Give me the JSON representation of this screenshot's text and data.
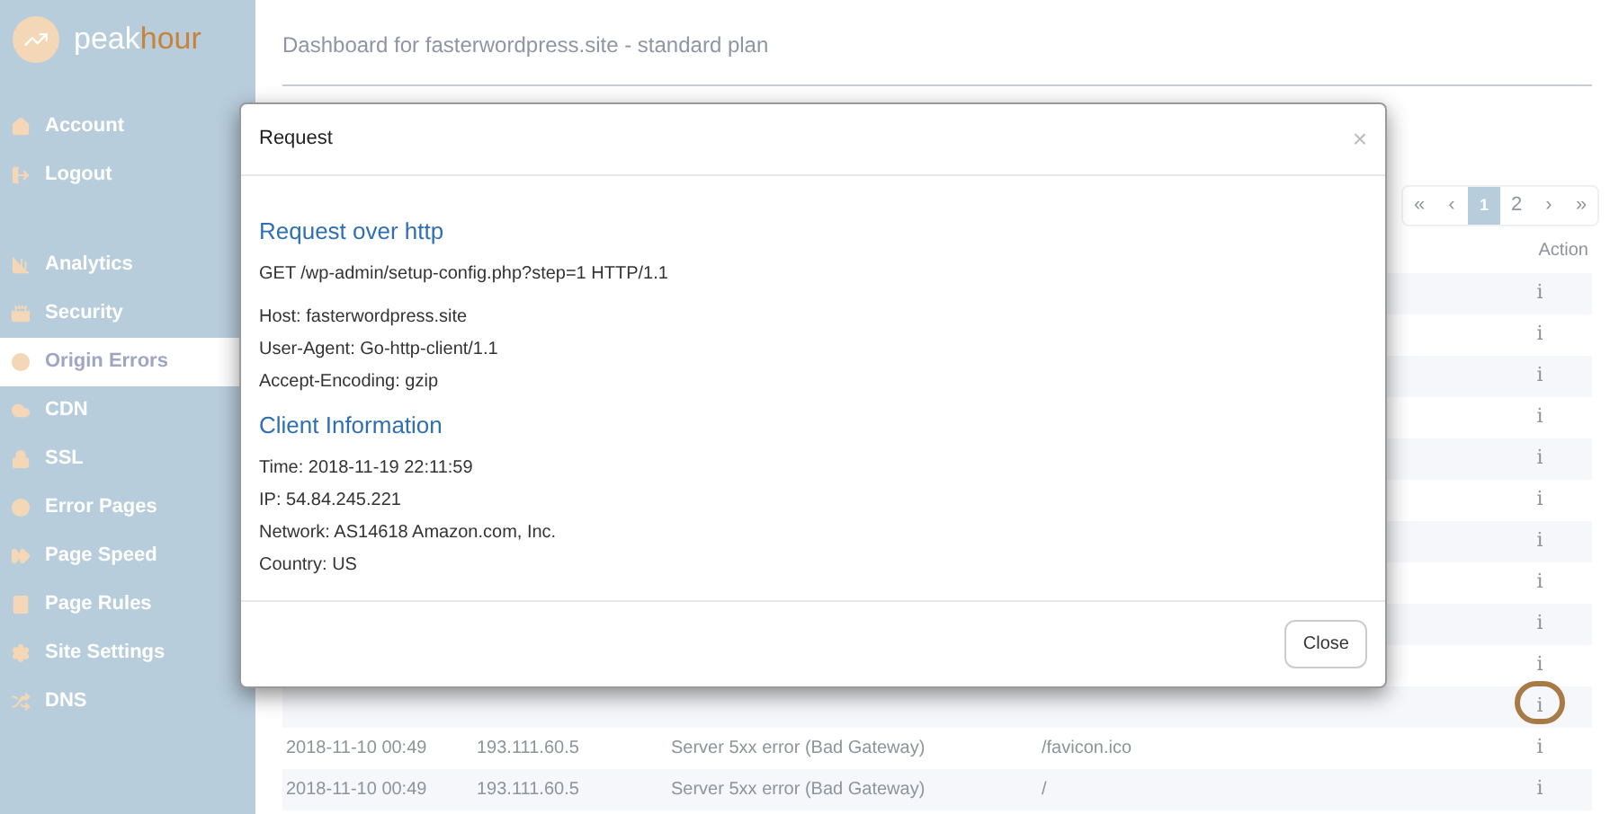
{
  "logo": {
    "text": [
      "peak",
      "hour"
    ]
  },
  "sidebar": {
    "top_items": [
      {
        "label": "Account",
        "selected": false
      },
      {
        "label": "Logout",
        "selected": false
      }
    ],
    "items": [
      {
        "label": "Analytics",
        "selected": false
      },
      {
        "label": "Security",
        "selected": false
      },
      {
        "label": "Origin Errors",
        "selected": true
      },
      {
        "label": "CDN",
        "selected": false
      },
      {
        "label": "SSL",
        "selected": false
      },
      {
        "label": "Error Pages",
        "selected": false
      },
      {
        "label": "Page Speed",
        "selected": false
      },
      {
        "label": "Page Rules",
        "selected": false
      },
      {
        "label": "Site Settings",
        "selected": false
      },
      {
        "label": "DNS",
        "selected": false
      }
    ]
  },
  "page_title": "Dashboard for fasterwordpress.site - standard plan",
  "pagination": [
    {
      "label": "«",
      "selected": false
    },
    {
      "label": "‹",
      "selected": false
    },
    {
      "label": "1",
      "selected": true
    },
    {
      "label": "2",
      "selected": false
    },
    {
      "label": "›",
      "selected": false
    },
    {
      "label": "»",
      "selected": false
    }
  ],
  "table": {
    "columns": [
      "Action"
    ],
    "rows": [
      {
        "cells": [],
        "action": "i",
        "highlighted": false
      },
      {
        "cells": [],
        "action": "i",
        "highlighted": false
      },
      {
        "cells": [],
        "action": "i",
        "highlighted": false
      },
      {
        "cells": [],
        "action": "i",
        "highlighted": false
      },
      {
        "cells": [],
        "action": "i",
        "highlighted": false
      },
      {
        "cells": [],
        "action": "i",
        "highlighted": false
      },
      {
        "cells": [],
        "action": "i",
        "highlighted": false
      },
      {
        "cells": [],
        "action": "i",
        "highlighted": false
      },
      {
        "cells": [],
        "action": "i",
        "highlighted": false
      },
      {
        "cells": [],
        "action": "i",
        "highlighted": false
      },
      {
        "cells": [],
        "action": "i",
        "highlighted": true
      },
      {
        "cells": [
          "2018-11-10 00:49",
          "193.111.60.5",
          "Server 5xx error (Bad Gateway)",
          "/favicon.ico"
        ],
        "action": "i",
        "highlighted": false
      },
      {
        "cells": [
          "2018-11-10 00:49",
          "193.111.60.5",
          "Server 5xx error (Bad Gateway)",
          "/"
        ],
        "action": "i",
        "highlighted": false
      }
    ]
  },
  "modal": {
    "title": "Request",
    "close_icon": "×",
    "sections": [
      {
        "heading": "Request over http",
        "groups": [
          [
            "GET /wp-admin/setup-config.php?step=1 HTTP/1.1"
          ],
          [
            "Host: fasterwordpress.site",
            "User-Agent: Go-http-client/1.1",
            "Accept-Encoding: gzip"
          ]
        ]
      },
      {
        "heading": "Client Information",
        "groups": [
          [
            "Time: 2018-11-19 22:11:59",
            "IP: 54.84.245.221",
            "Network: AS14618 Amazon.com, Inc.",
            "Country: US"
          ]
        ]
      }
    ],
    "button": "Close"
  }
}
